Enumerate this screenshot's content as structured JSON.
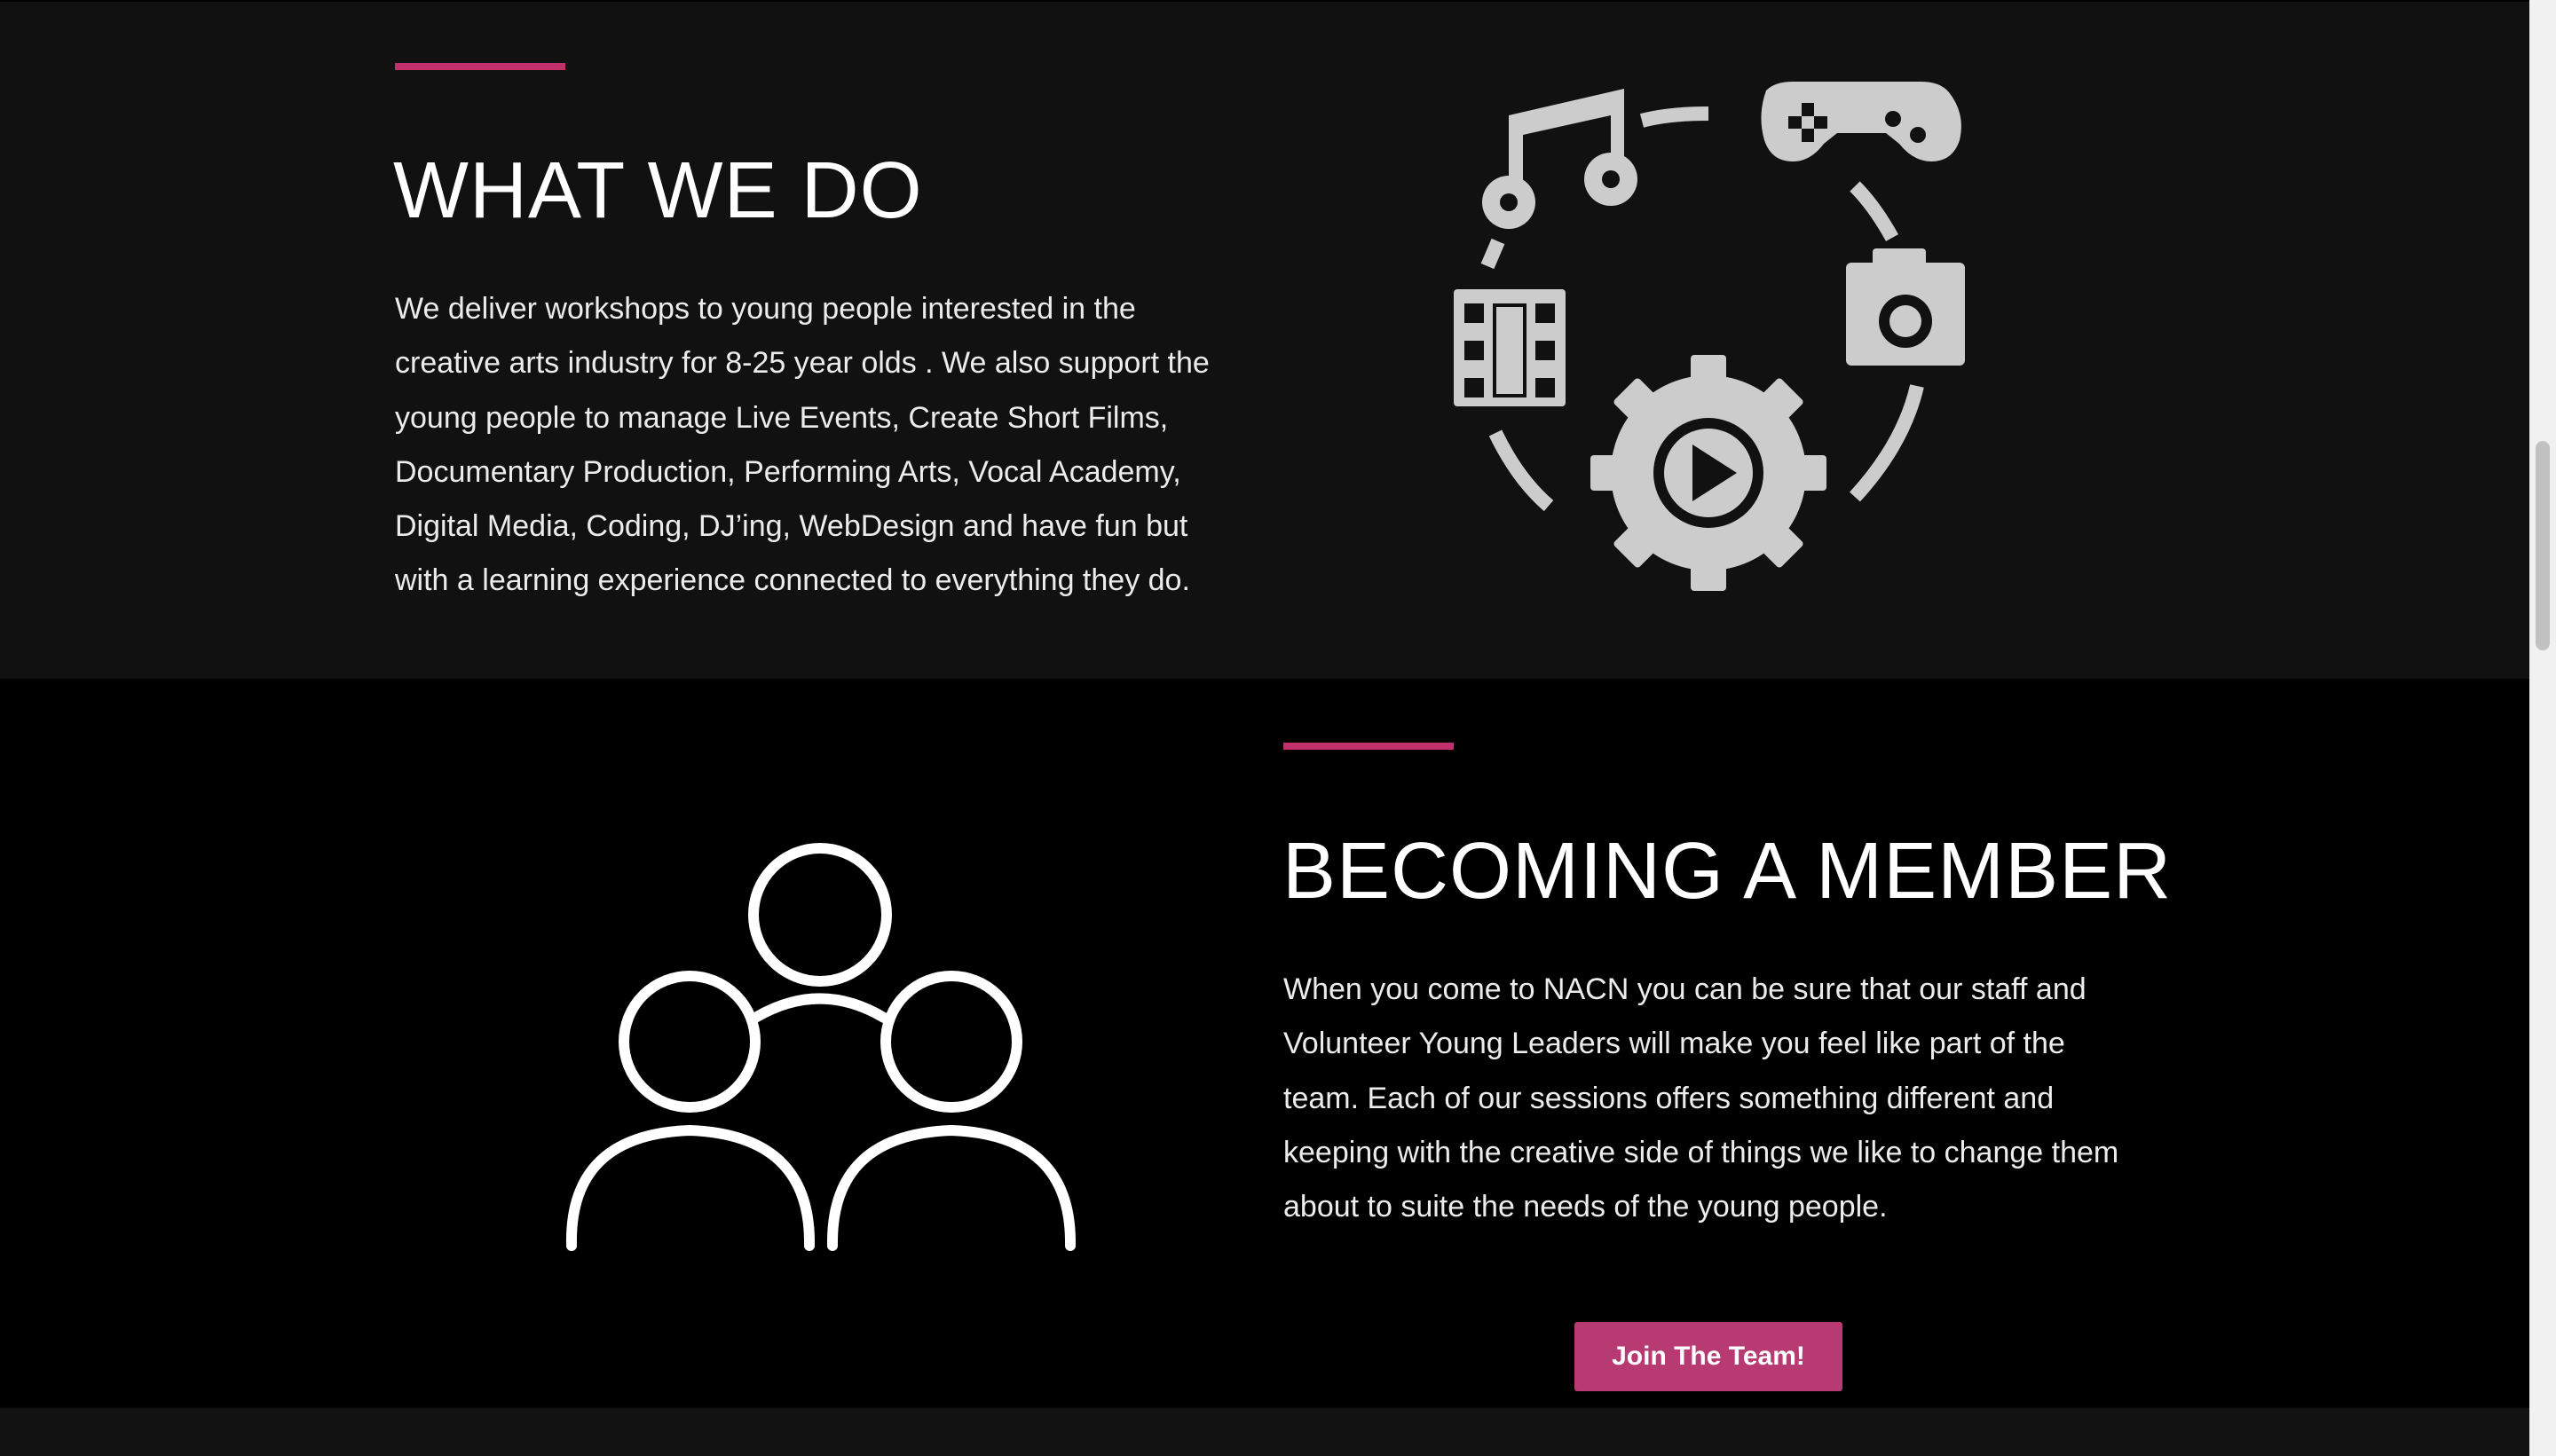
{
  "what_we_do": {
    "heading": "WHAT WE DO",
    "body": "We deliver workshops to young people interested in the creative arts industry for 8-25 year olds . We also support the young people to manage Live Events, Create Short Films, Documentary Production, Performing Arts, Vocal Academy, Digital Media, Coding, DJ’ing, WebDesign and have fun but with a learning experience connected to everything they do.",
    "illustration_icons": [
      "music-note-icon",
      "gamepad-icon",
      "film-strip-icon",
      "camera-icon",
      "gear-play-icon"
    ]
  },
  "becoming_a_member": {
    "heading": "BECOMING A MEMBER",
    "body": "When you come to NACN you can be sure that our staff and Volunteer Young Leaders will make you feel like part of the team. Each of our sessions offers something different and keeping with the creative side of things we like to change them about to suite the needs of the young people.",
    "illustration_icon": "group-of-people-icon",
    "join_button_label": "Join The Team!"
  },
  "colors": {
    "accent": "#c2306c",
    "button": "#b83a72",
    "section_dark": "#111111",
    "section_black": "#000000",
    "icon_gray": "#cccccc",
    "text_white": "#ffffff"
  }
}
